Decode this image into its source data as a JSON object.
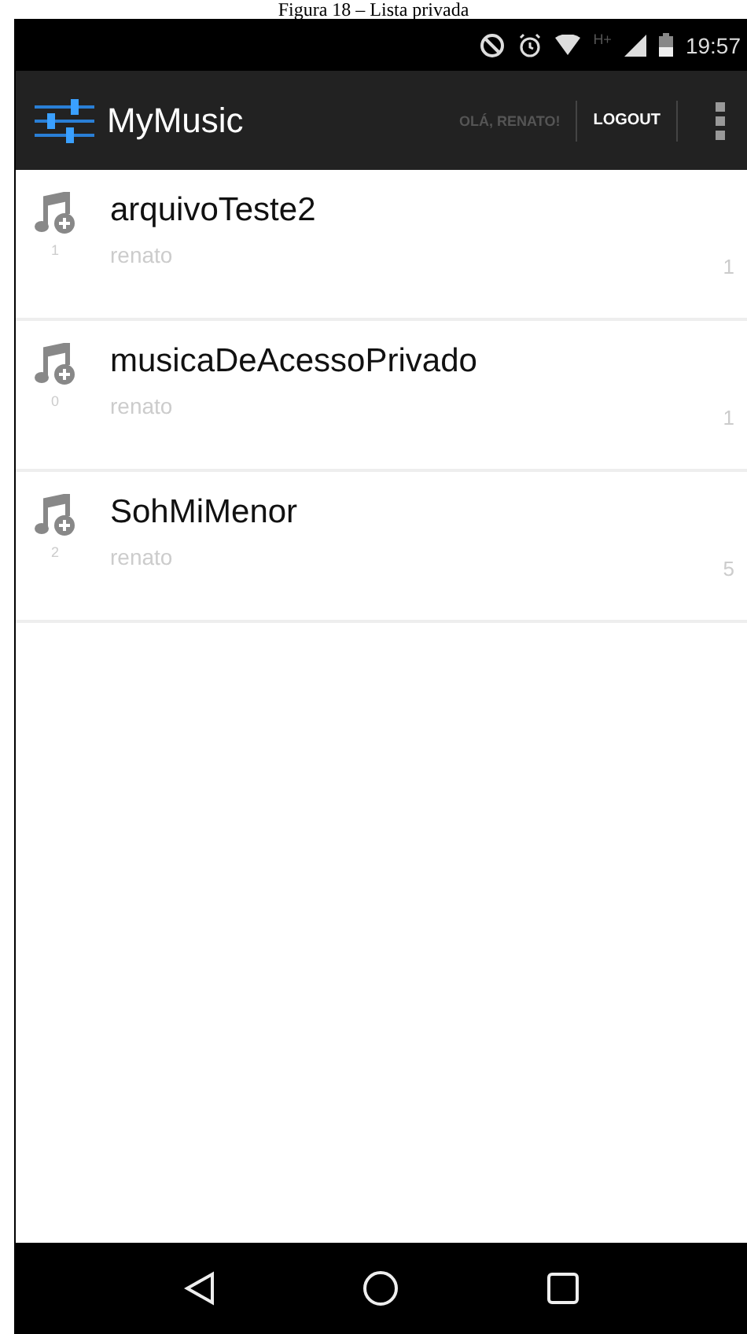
{
  "caption": "Figura 18 – Lista privada",
  "status_bar": {
    "time": "19:57",
    "network": "H+"
  },
  "app_bar": {
    "title": "MyMusic",
    "greeting": "OLÁ, RENATO!",
    "logout": "LOGOUT"
  },
  "songs": [
    {
      "title": "arquivoTeste2",
      "owner": "renato",
      "index": "1",
      "count": "1"
    },
    {
      "title": "musicaDeAcessoPrivado",
      "owner": "renato",
      "index": "0",
      "count": "1"
    },
    {
      "title": "SohMiMenor",
      "owner": "renato",
      "index": "2",
      "count": "5"
    }
  ]
}
